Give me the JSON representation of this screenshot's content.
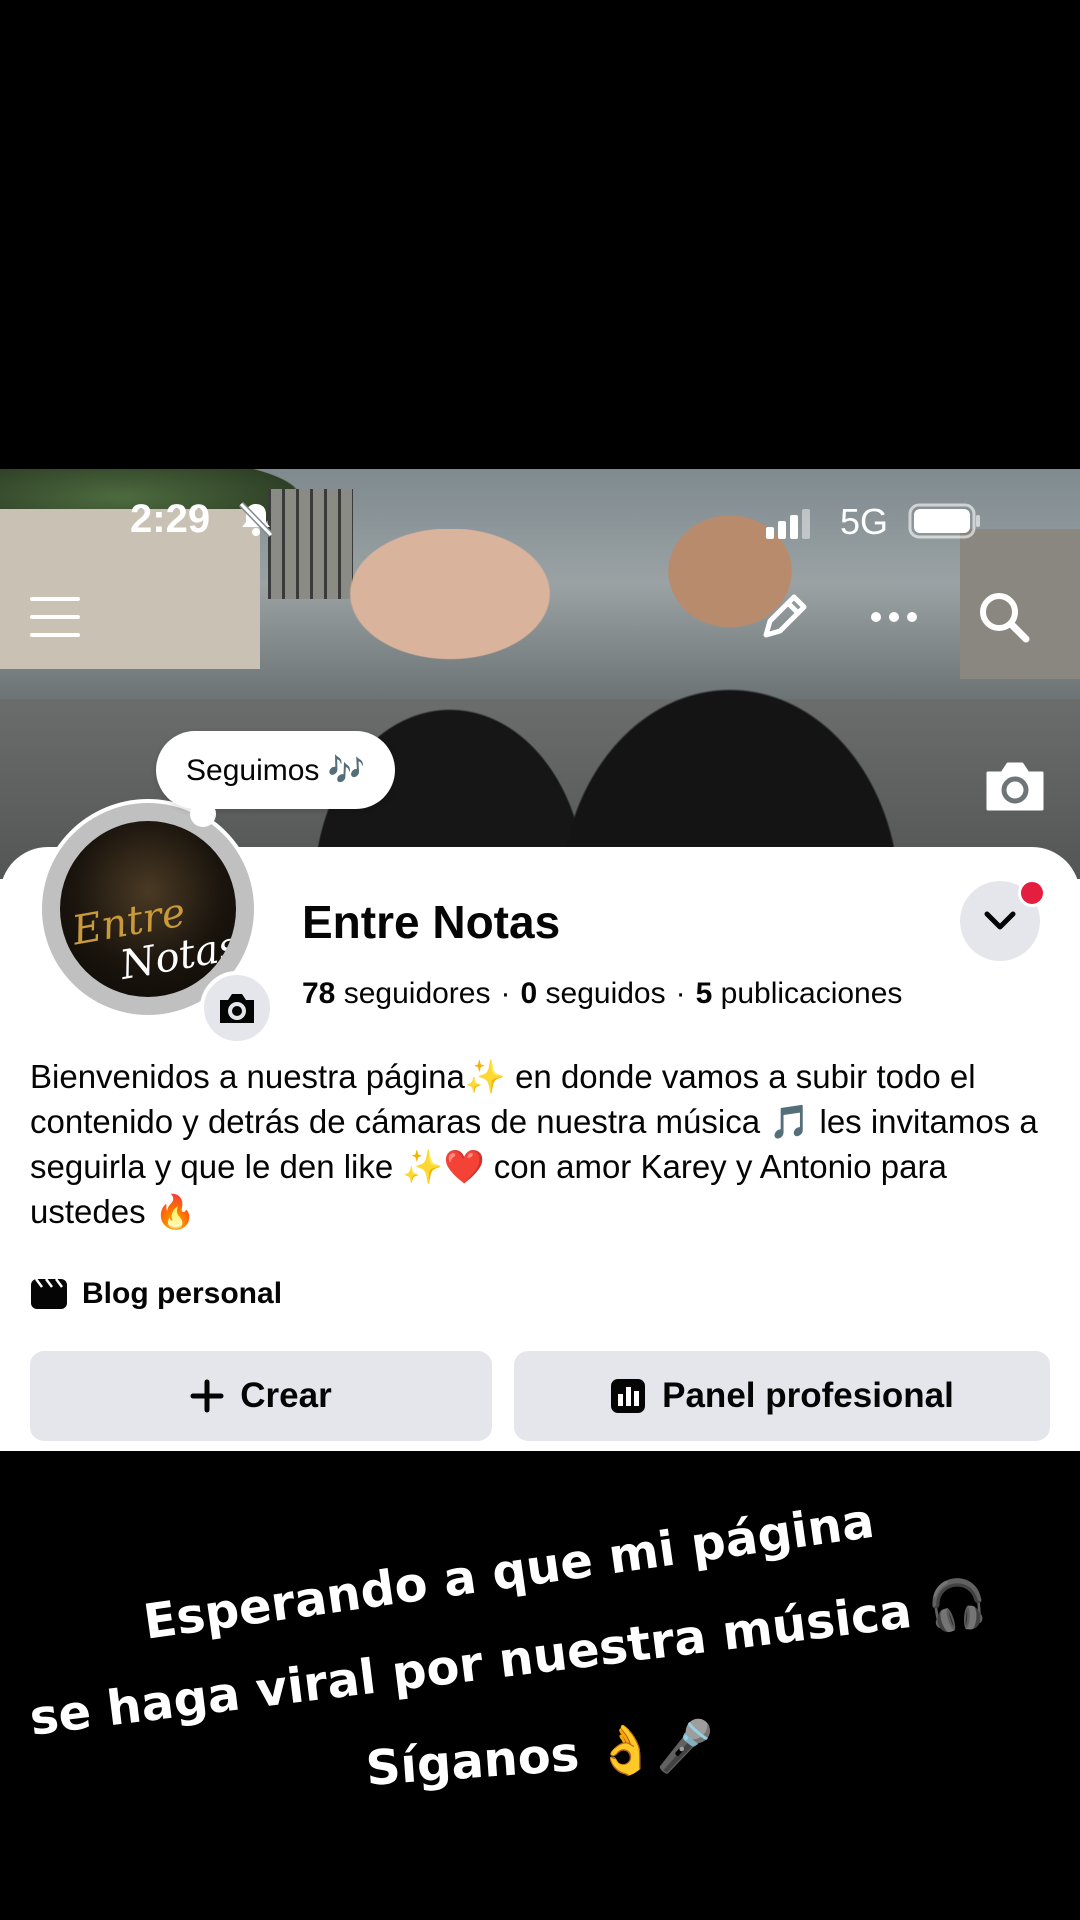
{
  "status_bar": {
    "time": "2:29",
    "network": "5G"
  },
  "note": "Seguimos 🎶",
  "profile": {
    "name": "Entre Notas",
    "avatar_logo_line1": "Entre",
    "avatar_logo_line2": "Notas",
    "stats": {
      "followers_count": "78",
      "followers_label": "seguidores",
      "following_count": "0",
      "following_label": "seguidos",
      "posts_count": "5",
      "posts_label": "publicaciones",
      "separator": "·"
    },
    "bio": "Bienvenidos a nuestra página✨ en donde vamos a subir todo el contenido y detrás de cámaras de nuestra música 🎵 les invitamos a seguirla y que le den like ✨❤️ con amor Karey y Antonio para ustedes 🔥",
    "category": "Blog personal"
  },
  "actions": {
    "create_label": "Crear",
    "panel_label": "Panel profesional"
  },
  "caption": {
    "line1": "Esperando  a que mi página",
    "line2": "se haga viral por nuestra música 🎧",
    "line3": "Síganos  👌🎤"
  },
  "colors": {
    "button_bg": "#e4e6eb",
    "notification_dot": "#e41e3f",
    "text": "#050505"
  },
  "icons": [
    "bell-slash-icon",
    "signal-icon",
    "battery-icon",
    "menu-icon",
    "pencil-icon",
    "more-icon",
    "search-icon",
    "camera-icon",
    "chevron-down-icon",
    "clapperboard-icon",
    "plus-icon",
    "chart-icon",
    "headphones-icon"
  ]
}
